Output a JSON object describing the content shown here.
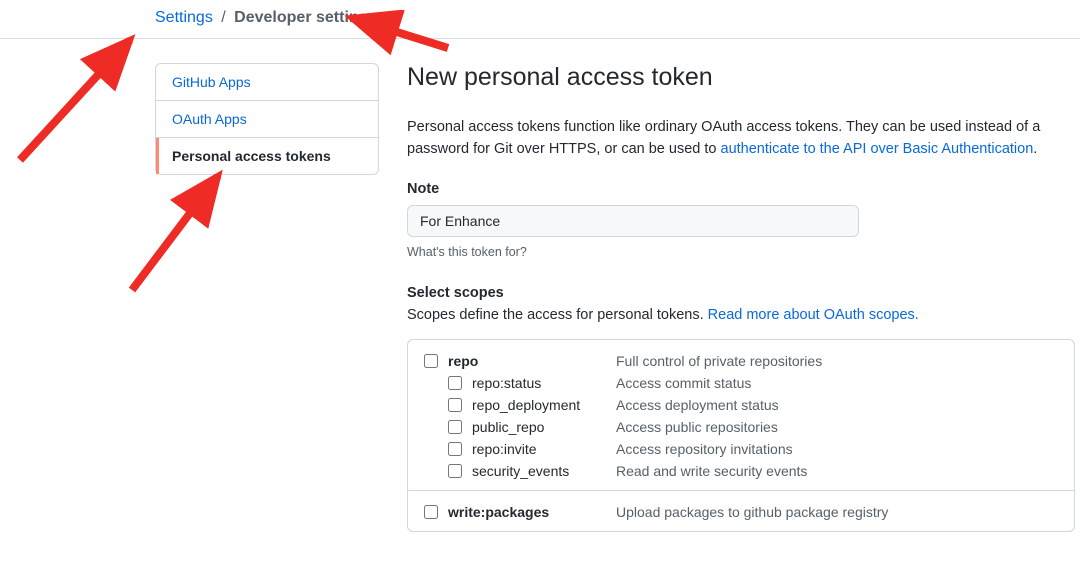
{
  "breadcrumb": {
    "settings": "Settings",
    "sep": "/",
    "developer": "Developer settings"
  },
  "sidebar": {
    "items": [
      {
        "label": "GitHub Apps"
      },
      {
        "label": "OAuth Apps"
      },
      {
        "label": "Personal access tokens"
      }
    ]
  },
  "page": {
    "title": "New personal access token",
    "desc_pre": "Personal access tokens function like ordinary OAuth access tokens. They can be used instead of a password for Git over HTTPS, or can be used to ",
    "desc_link": "authenticate to the API over Basic Authentication",
    "desc_post": "."
  },
  "note": {
    "label": "Note",
    "value": "For Enhance",
    "hint": "What's this token for?"
  },
  "scopes_header": {
    "title": "Select scopes",
    "sub_pre": "Scopes define the access for personal tokens. ",
    "sub_link": "Read more about OAuth scopes."
  },
  "scopes": [
    {
      "name": "repo",
      "desc": "Full control of private repositories",
      "children": [
        {
          "name": "repo:status",
          "desc": "Access commit status"
        },
        {
          "name": "repo_deployment",
          "desc": "Access deployment status"
        },
        {
          "name": "public_repo",
          "desc": "Access public repositories"
        },
        {
          "name": "repo:invite",
          "desc": "Access repository invitations"
        },
        {
          "name": "security_events",
          "desc": "Read and write security events"
        }
      ]
    },
    {
      "name": "write:packages",
      "desc": "Upload packages to github package registry",
      "children": []
    }
  ]
}
